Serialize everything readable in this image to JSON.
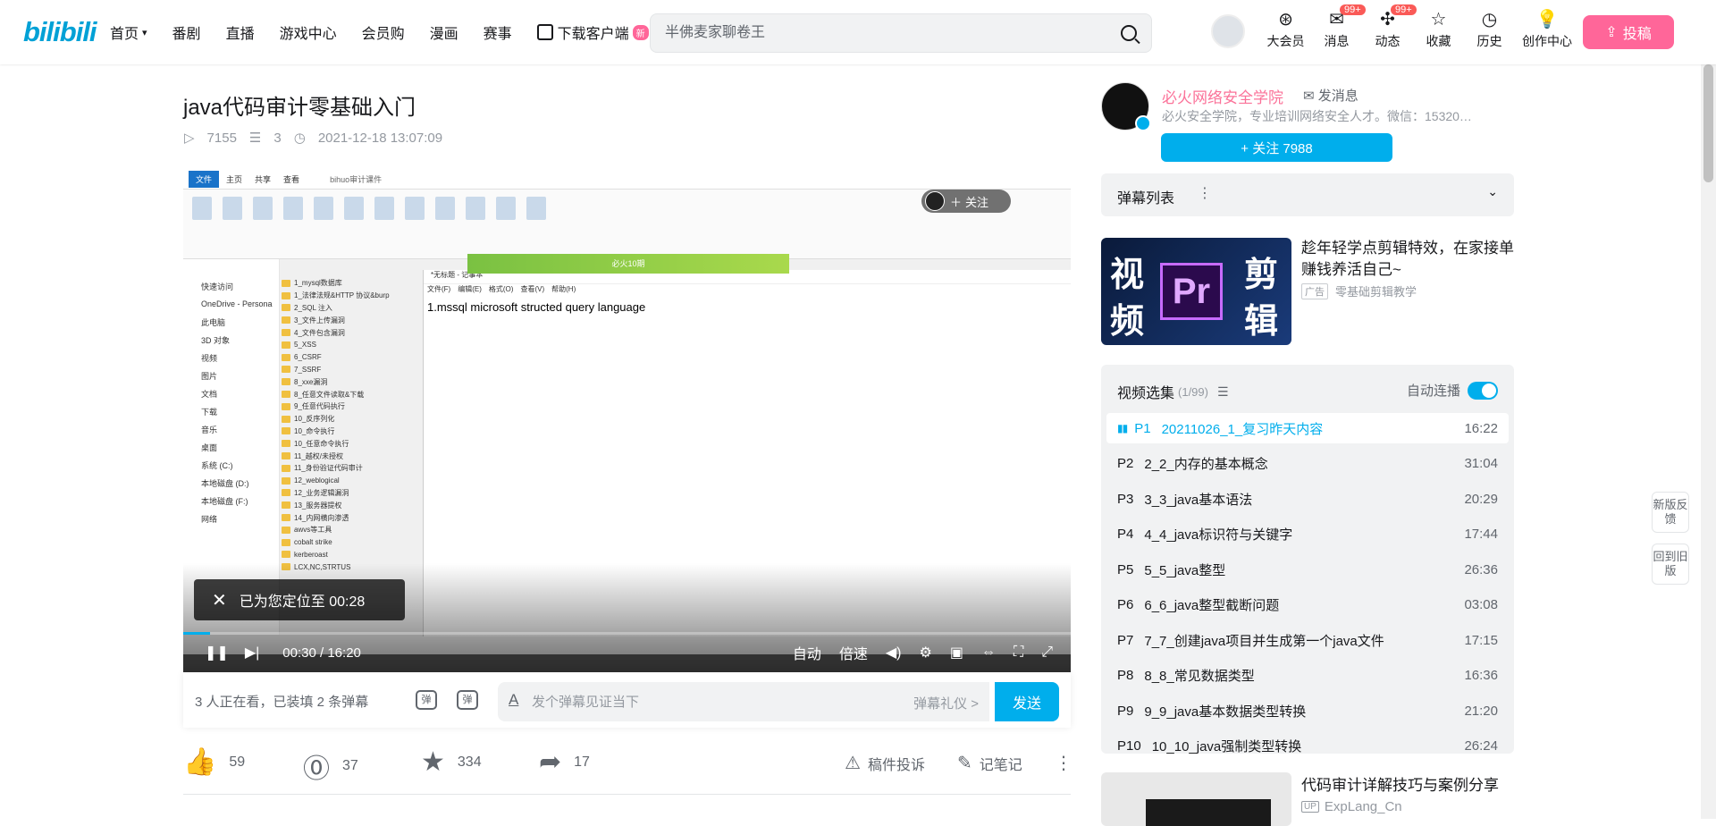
{
  "header": {
    "logo": "bilibili",
    "nav": [
      "首页",
      "番剧",
      "直播",
      "游戏中心",
      "会员购",
      "漫画",
      "赛事",
      "下载客户端"
    ],
    "nav_new_badge": "新",
    "search_placeholder": "半佛麦家聊卷王",
    "right_icons": [
      {
        "label": "大会员",
        "icon": "vip-icon"
      },
      {
        "label": "消息",
        "icon": "message-icon",
        "count": "99+"
      },
      {
        "label": "动态",
        "icon": "dynamic-icon",
        "count": "99+"
      },
      {
        "label": "收藏",
        "icon": "star-icon"
      },
      {
        "label": "历史",
        "icon": "history-icon"
      },
      {
        "label": "创作中心",
        "icon": "creator-icon"
      }
    ],
    "upload_label": "投稿"
  },
  "video": {
    "title": "java代码审计零基础入门",
    "views": "7155",
    "danmaku_count": "3",
    "date": "2021-12-18 13:07:09"
  },
  "player": {
    "follow_label": "关注",
    "toast": "已为您定位至 00:28",
    "time_current": "00:30",
    "time_total": "16:20",
    "progress": 0.03,
    "auto_label": "自动",
    "speed_label": "倍速",
    "screen_text": "1.mssql microsoft structed query language",
    "explorer_folder": "bihuo审计课件",
    "popup_text": "必火10期",
    "explorer_tabs": [
      "文件",
      "主页",
      "共享",
      "查看"
    ],
    "nav_items": [
      "快速访问",
      "OneDrive - Persona",
      "此电脑",
      "3D 对象",
      "视频",
      "图片",
      "文档",
      "下载",
      "音乐",
      "桌面",
      "系统 (C:)",
      "本地磁盘 (D:)",
      "本地磁盘 (F:)",
      "网络"
    ],
    "files": [
      "1_mysql数据库",
      "1_法律法规&HTTP 协议&burp",
      "2_SQL 注入",
      "3_文件上传漏洞",
      "4_文件包含漏洞",
      "5_XSS",
      "6_CSRF",
      "7_SSRF",
      "8_xxe漏洞",
      "8_任意文件读取&下载",
      "9_任意代码执行",
      "10_反序列化",
      "10_命令执行",
      "10_任意命令执行",
      "11_越权/未授权",
      "11_身份验证代码审计",
      "12_weblogical",
      "12_业务逻辑漏洞",
      "13_服务器提权",
      "14_内网横向渗透",
      "awvs等工具",
      "cobalt strike",
      "kerberoast",
      "LCX,NC,STRTUS"
    ],
    "notepad_title": "*无标题 - 记事本",
    "notepad_menu": [
      "文件(F)",
      "编辑(E)",
      "格式(O)",
      "查看(V)",
      "帮助(H)"
    ]
  },
  "danmaku_bar": {
    "viewers": "3 人正在看，已装填 2 条弹幕",
    "switch_label": "弹",
    "settings_label": "弹",
    "input_placeholder": "发个弹幕见证当下",
    "etiquette": "弹幕礼仪 >",
    "send_label": "发送"
  },
  "actions": {
    "like": "59",
    "coin": "37",
    "favorite": "334",
    "share": "17",
    "report": "稿件投诉",
    "note": "记笔记"
  },
  "uploader": {
    "name": "必火网络安全学院",
    "message": "发消息",
    "desc": "必火安全学院，专业培训网络安全人才。微信：15320…",
    "follow": "+ 关注 7988"
  },
  "danmaku_list": {
    "label": "弹幕列表"
  },
  "ad": {
    "title": "趁年轻学点剪辑特效，在家接单赚钱养活自己~",
    "tag": "广告",
    "source": "零基础剪辑教学",
    "chars": [
      "视",
      "剪",
      "频",
      "辑"
    ],
    "pr": "Pr"
  },
  "playlist": {
    "title": "视频选集",
    "count": "(1/99)",
    "autoplay": "自动连播",
    "episodes": [
      {
        "num": "P1",
        "title": "20211026_1_复习昨天内容",
        "dur": "16:22"
      },
      {
        "num": "P2",
        "title": "2_2_内存的基本概念",
        "dur": "31:04"
      },
      {
        "num": "P3",
        "title": "3_3_java基本语法",
        "dur": "20:29"
      },
      {
        "num": "P4",
        "title": "4_4_java标识符与关键字",
        "dur": "17:44"
      },
      {
        "num": "P5",
        "title": "5_5_java整型",
        "dur": "26:36"
      },
      {
        "num": "P6",
        "title": "6_6_java整型截断问题",
        "dur": "03:08"
      },
      {
        "num": "P7",
        "title": "7_7_创建java项目并生成第一个java文件",
        "dur": "17:15"
      },
      {
        "num": "P8",
        "title": "8_8_常见数据类型",
        "dur": "16:36"
      },
      {
        "num": "P9",
        "title": "9_9_java基本数据类型转换",
        "dur": "21:20"
      },
      {
        "num": "P10",
        "title": "10_10_java强制类型转换",
        "dur": "26:24"
      }
    ]
  },
  "recommend": {
    "title": "代码审计详解技巧与案例分享",
    "up": "ExpLang_Cn"
  },
  "side": {
    "new_feedback": "新版反馈",
    "back_old": "回到旧版"
  }
}
